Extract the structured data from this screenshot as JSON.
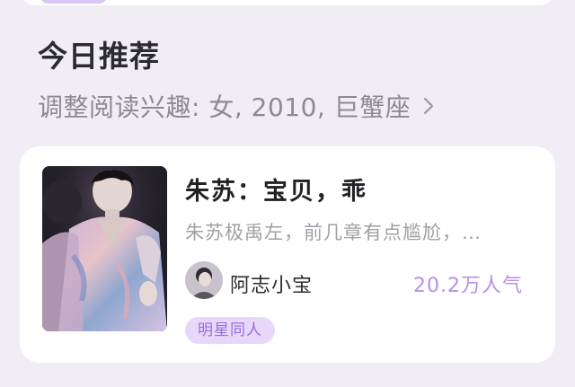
{
  "recommend": {
    "title": "今日推荐",
    "interest_text": "调整阅读兴趣: 女, 2010, 巨蟹座",
    "chevron_icon": "chevron-right-icon"
  },
  "book": {
    "title": "朱苏：宝贝，乖",
    "description": "朱苏极禹左，前几章有点尴尬，…",
    "author": "阿志小宝",
    "popularity": "20.2万人气",
    "tag": "明星同人",
    "cover_icon": "book-cover-image",
    "avatar_icon": "author-avatar-image"
  },
  "colors": {
    "background": "#f1edf5",
    "card": "#ffffff",
    "accent": "#b790e6",
    "tag_bg": "#e7d8fa",
    "tag_text": "#9a6bdc",
    "muted_text": "#8d8a91"
  }
}
